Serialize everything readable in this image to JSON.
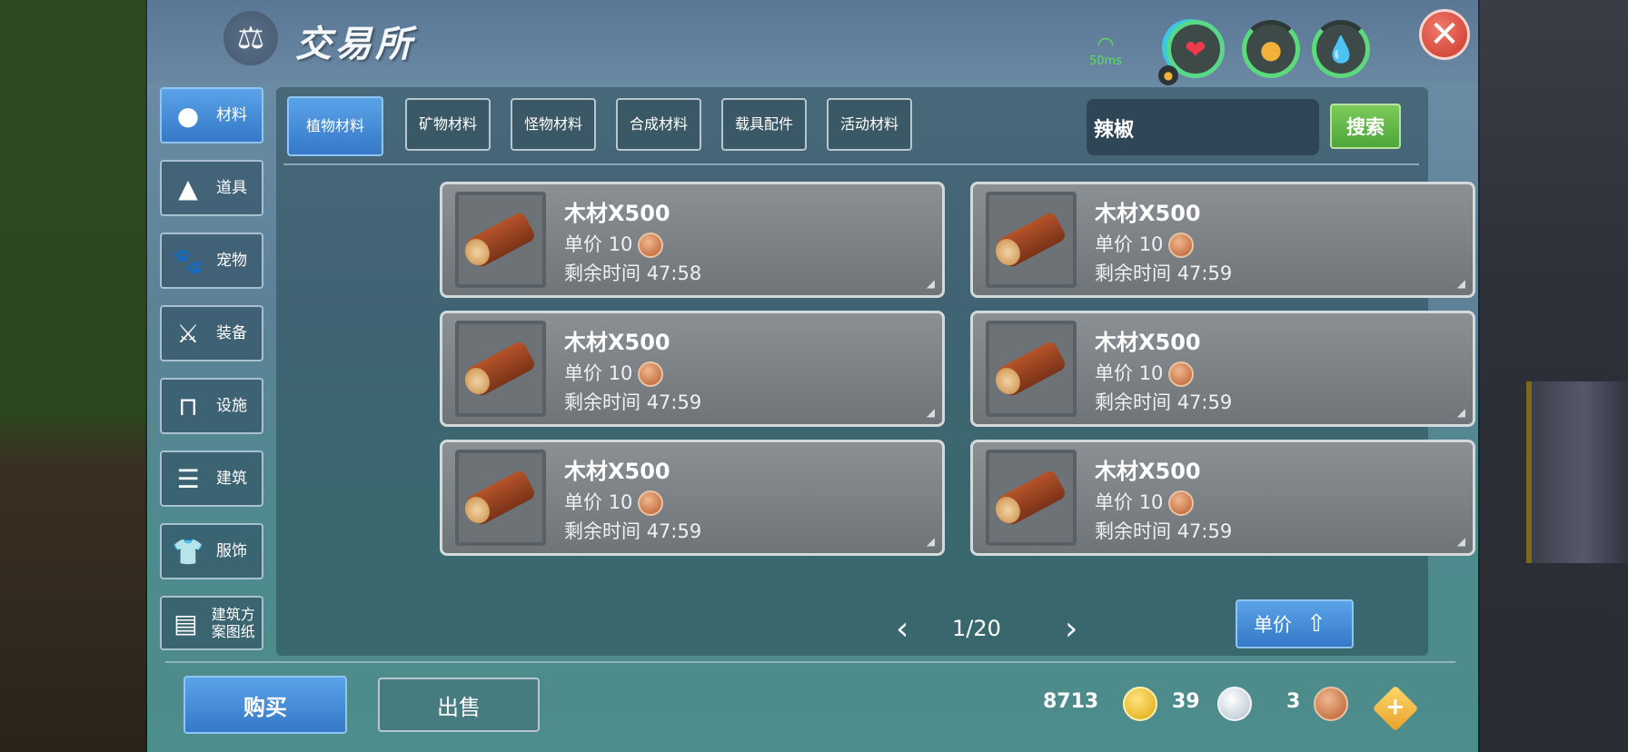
{
  "header": {
    "title": "交易所",
    "ping": "50ms",
    "icons": [
      "scale-icon",
      "wifi-icon",
      "heart-icon",
      "stomach-icon",
      "water-drop-icon",
      "close-icon"
    ]
  },
  "categories": [
    {
      "label": "材料",
      "icon": "materials-icon",
      "active": true
    },
    {
      "label": "道具",
      "icon": "flask-icon",
      "active": false
    },
    {
      "label": "宠物",
      "icon": "paw-icon",
      "active": false
    },
    {
      "label": "装备",
      "icon": "sword-icon",
      "active": false
    },
    {
      "label": "设施",
      "icon": "bench-icon",
      "active": false
    },
    {
      "label": "建筑",
      "icon": "wall-icon",
      "active": false
    },
    {
      "label": "服饰",
      "icon": "shirt-icon",
      "active": false
    },
    {
      "label": "建筑方案图纸",
      "icon": "blueprint-icon",
      "active": false
    }
  ],
  "subtabs": [
    {
      "label": "植物材料",
      "active": true
    },
    {
      "label": "矿物材料",
      "active": false
    },
    {
      "label": "怪物材料",
      "active": false
    },
    {
      "label": "合成材料",
      "active": false
    },
    {
      "label": "载具配件",
      "active": false
    },
    {
      "label": "活动材料",
      "active": false
    }
  ],
  "search": {
    "value": "辣椒",
    "button": "搜索"
  },
  "listings": [
    {
      "name": "木材X500",
      "price_label": "单价",
      "price": "10",
      "time_label": "剩余时间",
      "time": "47:58"
    },
    {
      "name": "木材X500",
      "price_label": "单价",
      "price": "10",
      "time_label": "剩余时间",
      "time": "47:59"
    },
    {
      "name": "木材X500",
      "price_label": "单价",
      "price": "10",
      "time_label": "剩余时间",
      "time": "47:59"
    },
    {
      "name": "木材X500",
      "price_label": "单价",
      "price": "10",
      "time_label": "剩余时间",
      "time": "47:59"
    },
    {
      "name": "木材X500",
      "price_label": "单价",
      "price": "10",
      "time_label": "剩余时间",
      "time": "47:59"
    },
    {
      "name": "木材X500",
      "price_label": "单价",
      "price": "10",
      "time_label": "剩余时间",
      "time": "47:59"
    }
  ],
  "pager": {
    "text": "1/20"
  },
  "sort": {
    "label": "单价"
  },
  "footer": {
    "buy": "购买",
    "sell": "出售",
    "gold": "8713",
    "silver": "39",
    "copper": "3"
  },
  "colors": {
    "accent_blue": "#3578c8",
    "search_green": "#4ea63a",
    "close_red": "#d64b3d",
    "ping_green": "#57e25a"
  }
}
